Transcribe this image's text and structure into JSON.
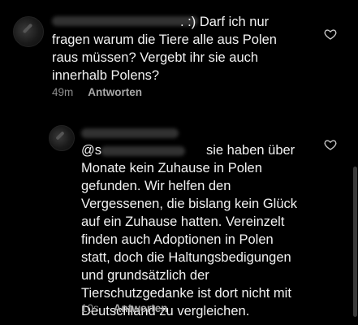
{
  "comments": [
    {
      "text": "Darf ich nur fragen warum die Tiere alle aus Polen raus müssen? Vergebt ihr sie auch innerhalb Polens?",
      "first_line_tail": ". :) Darf ich nur",
      "line2": "fragen warum die Tiere alle aus Polen",
      "line3": "raus müssen? Vergebt ihr sie auch",
      "line4": "innerhalb Polens?",
      "time": "49m",
      "reply_label": "Antworten"
    },
    {
      "mention_prefix": "@s",
      "first_line_tail": "sie haben über",
      "line2": "Monate kein Zuhause in Polen",
      "line3": "gefunden. Wir helfen den",
      "line4": "Vergessenen, die bislang kein Glück",
      "line5": "auf ein Zuhause hatten. Vereinzelt",
      "line6": "finden auch Adoptionen in Polen",
      "line7": "statt, doch die Haltungsbedigungen",
      "line8": "und grundsätzlich der",
      "line9": "Tierschutzgedanke ist dort nicht mit",
      "line10": "Deutschland zu vergleichen.",
      "time": "10s",
      "reply_label": "Antworten"
    }
  ],
  "icons": {
    "like": "heart-icon",
    "avatar": "avatar"
  },
  "colors": {
    "background": "#000000",
    "text": "#f2f2f2",
    "meta": "#8e8e8e"
  }
}
